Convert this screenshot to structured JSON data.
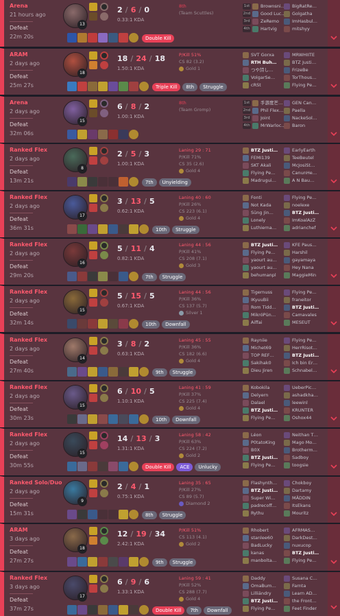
{
  "colors": {
    "loss_bg": "#59343f",
    "loss_accent": "#e84057",
    "kill_tag": "#e84057",
    "ace_tag": "#7d5cd8",
    "neutral_tag": "#6a6878"
  },
  "icons": {
    "expand": "chevron-down-icon"
  },
  "matches": [
    {
      "mode": "Arena",
      "ago": "21 hours ago",
      "result": "Defeat",
      "duration": "22m 20s",
      "level": "13",
      "kda": {
        "k": "2",
        "d": "6",
        "a": "0"
      },
      "ratio": "0.33:1 KDA",
      "champ_color": "#8a6a6a",
      "spells": [
        "#c9a227",
        "#6b4c2a"
      ],
      "rune_color": "#8a6a6a",
      "stats": {
        "line1": "8th",
        "line2": "(Team Scuttles)",
        "line3": "",
        "tier": ""
      },
      "arena": true,
      "items": [
        "#2d55a8",
        "#b07a30",
        "#c03c3c",
        "#8a6ac0",
        "#3a5a80",
        "#c04040"
      ],
      "tags": [
        {
          "label": "Double Kill",
          "kind": "red"
        }
      ],
      "team1": [
        "Brownsni…",
        "Good Luc…",
        "ZeRemo",
        "Hartvig"
      ],
      "team2": [
        "BigRatRe…",
        "Golgatha",
        "ImHasbul…",
        "mitshyy"
      ],
      "places": [
        "1st",
        "2nd",
        "3rd",
        "4th"
      ]
    },
    {
      "mode": "ARAM",
      "ago": "2 days ago",
      "result": "Defeat",
      "duration": "25m 27s",
      "level": "18",
      "kda": {
        "k": "18",
        "d": "24",
        "a": "18"
      },
      "ratio": "1.50:1 KDA",
      "champ_color": "#b05040",
      "spells": [
        "#c9a227",
        "#d08030"
      ],
      "rune_color": "#c04040",
      "stats": {
        "line1": "P/Kill 51%",
        "line2": "CS 82 (3.2)",
        "line3": "Gold 1",
        "tier": ""
      },
      "items": [
        "#3a7ac0",
        "#c04040",
        "#8a6a3a",
        "#c0a030",
        "#6a4c9a",
        "#5a8a4a",
        "#a04040"
      ],
      "tags": [
        {
          "label": "Triple Kill",
          "kind": "red"
        },
        {
          "label": "8th",
          "kind": "n"
        },
        {
          "label": "Struggle",
          "kind": "n"
        }
      ],
      "team1": [
        "SVT Gorxa",
        "RTH Buh…",
        "つや詩し…",
        "VolgarSe…",
        "cRSt"
      ],
      "team2": [
        "MRWHIITE",
        "BTZ Justi…",
        "FrizeBe",
        "TorThous…",
        "Flying Pe…"
      ],
      "me": [
        0,
        1
      ]
    },
    {
      "mode": "Arena",
      "ago": "2 days ago",
      "result": "Defeat",
      "duration": "32m 06s",
      "level": "15",
      "kda": {
        "k": "6",
        "d": "8",
        "a": "2"
      },
      "ratio": "1.00:1 KDA",
      "champ_color": "#8060a0",
      "spells": [
        "#c9a227",
        "#6b4c2a"
      ],
      "rune_color": "#806080",
      "stats": {
        "line1": "8th",
        "line2": "(Team Gromp)",
        "line3": "",
        "tier": ""
      },
      "arena": true,
      "items": [
        "#3a5aa0",
        "#c0a030",
        "#6a3a6a",
        "#8a6a4a",
        "#8a3030",
        "#3a3a5a"
      ],
      "tags": [],
      "team1": [
        "手游度芒…",
        "Phil Flex…",
        "Joint",
        "MrWarloc…"
      ],
      "team2": [
        "GEN Can…",
        "Paella",
        "NackeSol…",
        "Baron"
      ],
      "places": [
        "1st",
        "2nd",
        "3rd",
        "4th"
      ]
    },
    {
      "mode": "Ranked Flex",
      "ago": "2 days ago",
      "result": "Defeat",
      "duration": "13m 21s",
      "level": "8",
      "kda": {
        "k": "2",
        "d": "5",
        "a": "3"
      },
      "ratio": "1.00:1 KDA",
      "champ_color": "#4a6a5a",
      "spells": [
        "#c9a227",
        "#c04040"
      ],
      "rune_color": "#a04040",
      "stats": {
        "line1": "Laning 29 : 71",
        "line2": "P/Kill 71%",
        "line3": "CS 35 (2.6)",
        "tier": "Gold 4"
      },
      "items": [
        "#4a3a6a",
        "#8a8a4a",
        "#3a3a3a",
        "",
        "",
        "#c06030"
      ],
      "tags": [
        {
          "label": "7th",
          "kind": "n"
        },
        {
          "label": "Unyielding",
          "kind": "n"
        }
      ],
      "team1": [
        "BTZ Justi…",
        "FEMI139",
        "SKT Akali",
        "Flying Pe…",
        "Madrugui…"
      ],
      "team2": [
        "EarlyEarth",
        "TeeBeutel",
        "McJosiSt…",
        "CanunHe…",
        "A N Bau…"
      ],
      "me": [
        0,
        0
      ]
    },
    {
      "mode": "Ranked Flex",
      "ago": "2 days ago",
      "result": "Defeat",
      "duration": "36m 31s",
      "level": "17",
      "kda": {
        "k": "3",
        "d": "13",
        "a": "5"
      },
      "ratio": "0.62:1 KDA",
      "champ_color": "#4a5a9a",
      "spells": [
        "#c9a227",
        "#c04040"
      ],
      "rune_color": "#8a7a4a",
      "stats": {
        "line1": "Laning 40 : 60",
        "line2": "P/Kill 26%",
        "line3": "CS 223 (6.1)",
        "tier": "Gold 4"
      },
      "items": [
        "#8a4a4a",
        "#3a6a3a",
        "#6a4a8a",
        "#c0a030",
        "#3a5a8a",
        "#4a3a3a",
        "#c0a030"
      ],
      "tags": [
        {
          "label": "10th",
          "kind": "n"
        },
        {
          "label": "Struggle",
          "kind": "n"
        }
      ],
      "team1": [
        "Fonti",
        "Not Kada",
        "Süng Jin…",
        "Lonely",
        "Luthierna…"
      ],
      "team2": [
        "Flying Pe…",
        "noelexe",
        "BTZ Justi…",
        "ImKoalAzZ",
        "adrianchef"
      ],
      "me": [
        1,
        2
      ]
    },
    {
      "mode": "Ranked Flex",
      "ago": "2 days ago",
      "result": "Defeat",
      "duration": "29m 20s",
      "level": "16",
      "kda": {
        "k": "5",
        "d": "11",
        "a": "4"
      },
      "ratio": "0.82:1 KDA",
      "champ_color": "#7a3a3a",
      "spells": [
        "#c9a227",
        "#c04040"
      ],
      "rune_color": "#7a8a4a",
      "stats": {
        "line1": "Laning 44 : 56",
        "line2": "P/Kill 41%",
        "line3": "CS 208 (7.1)",
        "tier": "Gold 3"
      },
      "items": [
        "#4a5a8a",
        "#8a3a3a",
        "#3a3a3a",
        "#8a8a4a",
        "",
        "#3a5a8a"
      ],
      "tags": [
        {
          "label": "7th",
          "kind": "n"
        },
        {
          "label": "Struggle",
          "kind": "n"
        }
      ],
      "team1": [
        "BTZ Justi…",
        "Flying Pe…",
        "yaourt au…",
        "yaourt au…",
        "behumanpl"
      ],
      "team2": [
        "KFE Paus…",
        "Harshil",
        "gayamaya",
        "Hey Nana",
        "MaggieMin"
      ],
      "me": [
        0,
        0
      ]
    },
    {
      "mode": "Ranked Flex",
      "ago": "2 days ago",
      "result": "Defeat",
      "duration": "32m 14s",
      "level": "15",
      "kda": {
        "k": "5",
        "d": "15",
        "a": "5"
      },
      "ratio": "0.67:1 KDA",
      "champ_color": "#8a6a3a",
      "spells": [
        "#c9a227",
        "#c04040"
      ],
      "rune_color": "#a04040",
      "stats": {
        "line1": "Laning 44 : 56",
        "line2": "P/Kill 36%",
        "line3": "CS 137 (5.7)",
        "tier": "Silver 1"
      },
      "items": [
        "#3a4a6a",
        "#6a3a3a",
        "#8a3a3a",
        "#c0a030",
        "#5a4a3a",
        "#8a3a4a"
      ],
      "tags": [
        {
          "label": "10th",
          "kind": "n"
        },
        {
          "label": "Downfall",
          "kind": "n"
        }
      ],
      "team1": [
        "Tigernuss",
        "IKyuuBii",
        "Rom Tidd…",
        "MikróPün…",
        "Aiffai"
      ],
      "team2": [
        "Flying Pe…",
        "franeitor",
        "BTZ Justi…",
        "Camavales",
        "MESEUT"
      ],
      "me": [
        1,
        2
      ]
    },
    {
      "mode": "Ranked Flex",
      "ago": "2 days ago",
      "result": "Defeat",
      "duration": "27m 40s",
      "level": "14",
      "kda": {
        "k": "3",
        "d": "8",
        "a": "2"
      },
      "ratio": "0.63:1 KDA",
      "champ_color": "#a07a6a",
      "spells": [
        "#c9a227",
        "#c04040"
      ],
      "rune_color": "#8a7a4a",
      "stats": {
        "line1": "Laning 45 : 55",
        "line2": "P/Kill 36%",
        "line3": "CS 182 (6.6)",
        "tier": "Gold 4"
      },
      "items": [
        "#4a6a8a",
        "#6a4a8a",
        "#c0a030",
        "#3a5a8a",
        "#8a6a3a",
        "#4a3a3a",
        "#c0a030"
      ],
      "tags": [
        {
          "label": "9th",
          "kind": "n"
        },
        {
          "label": "Struggle",
          "kind": "n"
        }
      ],
      "team1": [
        "Rayniie",
        "Michet69",
        "TOP REF…",
        "Sakihak0",
        "Dieu Jiren"
      ],
      "team2": [
        "Flying Pe…",
        "HerrRisot…",
        "BTZ Justi…",
        "Ich bin Er…",
        "Schnabel…"
      ],
      "me": [
        1,
        2
      ]
    },
    {
      "mode": "Ranked Flex",
      "ago": "2 days ago",
      "result": "Defeat",
      "duration": "30m 23s",
      "level": "15",
      "kda": {
        "k": "6",
        "d": "10",
        "a": "5"
      },
      "ratio": "1.10:1 KDA",
      "champ_color": "#6a5a8a",
      "spells": [
        "#c9a227",
        "#c04040"
      ],
      "rune_color": "#8a7a4a",
      "stats": {
        "line1": "Laning 41 : 59",
        "line2": "P/Kill 37%",
        "line3": "CS 225 (7.4)",
        "tier": "Gold 4"
      },
      "items": [
        "#3a3a3a",
        "#6a6a8a",
        "#c0a030",
        "#8a4a4a",
        "#3a6a9a",
        "#4a4a5a",
        "#3a6a9a"
      ],
      "tags": [
        {
          "label": "10th",
          "kind": "n"
        },
        {
          "label": "Downfall",
          "kind": "n"
        }
      ],
      "team1": [
        "Kobokila",
        "Delyern",
        "Dalael",
        "BTZ Justi…",
        "Flying Pe…"
      ],
      "team2": [
        "UeberPic…",
        "ashadkha…",
        "leewinl",
        "KRUNTER",
        "Oshox44"
      ],
      "me": [
        0,
        3
      ]
    },
    {
      "mode": "Ranked Flex",
      "ago": "2 days ago",
      "result": "Defeat",
      "duration": "30m 55s",
      "level": "15",
      "kda": {
        "k": "14",
        "d": "13",
        "a": "3"
      },
      "ratio": "1.31:1 KDA",
      "champ_color": "#3a4a5a",
      "spells": [
        "#c9a227",
        "#c04040"
      ],
      "rune_color": "#a04060",
      "stats": {
        "line1": "Laning 58 : 42",
        "line2": "P/Kill 63%",
        "line3": "CS 224 (7.2)",
        "tier": "Gold 2"
      },
      "items": [
        "#3a6a9a",
        "#6a6a8a",
        "#8a3a3a",
        "#4a3a3a",
        "#8a4a6a",
        "#3a6a9a"
      ],
      "tags": [
        {
          "label": "Double Kill",
          "kind": "red"
        },
        {
          "label": "ACE",
          "kind": "ace"
        },
        {
          "label": "Unlucky",
          "kind": "n"
        }
      ],
      "team1": [
        "Léon",
        "P0tatoKing",
        "B0X",
        "BTZ Justi…",
        "Flying Pe…"
      ],
      "team2": [
        "Neithan T…",
        "Mago Mo…",
        "Brotherm…",
        "Sadboy",
        "toogsie"
      ],
      "me": [
        0,
        3
      ]
    },
    {
      "mode": "Ranked Solo/Duo",
      "ago": "2 days ago",
      "result": "Defeat",
      "duration": "15m 31s",
      "level": "9",
      "kda": {
        "k": "2",
        "d": "4",
        "a": "1"
      },
      "ratio": "0.75:1 KDA",
      "champ_color": "#3a7aa0",
      "spells": [
        "#c9a227",
        "#c04040"
      ],
      "rune_color": "#8a7a4a",
      "stats": {
        "line1": "Laning 35 : 65",
        "line2": "P/Kill 27%",
        "line3": "CS 89 (5.7)",
        "tier": "Diamond 2"
      },
      "items": [
        "#6a4a8a",
        "#3a3a3a",
        "#3a5a8a",
        "",
        "",
        "#c0a030"
      ],
      "tags": [
        {
          "label": "8th",
          "kind": "n"
        },
        {
          "label": "Struggle",
          "kind": "n"
        }
      ],
      "team1": [
        "Flashynth…",
        "BTZ Justi…",
        "Super Wi…",
        "padrecoff…",
        "Rythu"
      ],
      "team2": [
        "Chokboy",
        "Dartamy",
        "MÄDDIN",
        "ItsEkans",
        "Mouritz"
      ],
      "me": [
        0,
        1
      ]
    },
    {
      "mode": "ARAM",
      "ago": "3 days ago",
      "result": "Defeat",
      "duration": "27m 27s",
      "level": "18",
      "kda": {
        "k": "12",
        "d": "19",
        "a": "34"
      },
      "ratio": "2.42:1 KDA",
      "champ_color": "#8a6a4a",
      "spells": [
        "#c9a227",
        "#d08030"
      ],
      "rune_color": "#5a8a4a",
      "stats": {
        "line1": "P/Kill 51%",
        "line2": "CS 113 (4.1)",
        "line3": "Gold 2",
        "tier": ""
      },
      "items": [
        "#6a4a8a",
        "#3a6a9a",
        "#c0a030",
        "#8a3a3a",
        "#4a4a4a",
        "#5a3a6a",
        "#c0a030"
      ],
      "tags": [
        {
          "label": "9th",
          "kind": "n"
        },
        {
          "label": "Struggle",
          "kind": "n"
        }
      ],
      "team1": [
        "Rhobert",
        "stanlee60",
        "BadLucky",
        "kanas",
        "manbolta…"
      ],
      "team2": [
        "AFRMAS…",
        "DarkDest…",
        "nuxucop",
        "BTZ Justi…",
        "Flying Pe…"
      ],
      "me": [
        1,
        3
      ]
    },
    {
      "mode": "Ranked Flex",
      "ago": "3 days ago",
      "result": "Defeat",
      "duration": "37m 27s",
      "level": "17",
      "kda": {
        "k": "6",
        "d": "9",
        "a": "6"
      },
      "ratio": "1.33:1 KDA",
      "champ_color": "#4a4a6a",
      "spells": [
        "#c9a227",
        "#c04040"
      ],
      "rune_color": "#8a7a4a",
      "stats": {
        "line1": "Laning 59 : 41",
        "line2": "P/Kill 52%",
        "line3": "CS 288 (7.7)",
        "tier": "Gold 4"
      },
      "items": [
        "#3a6a9a",
        "#6a4a8a",
        "#3a3a3a",
        "#8a6a3a",
        "#3a5a8a",
        "#c0a030",
        "#4a3a3a"
      ],
      "tags": [
        {
          "label": "Double Kill",
          "kind": "red"
        },
        {
          "label": "7th",
          "kind": "n"
        },
        {
          "label": "Downfall",
          "kind": "n"
        }
      ],
      "team1": [
        "Daddy",
        "OmaBum…",
        "Lilliändry",
        "BTZ Justi…",
        "Flying Pe…"
      ],
      "team2": [
        "Susana C…",
        "Farnta",
        "Learn AD…",
        "the Front…",
        "Feet Finder"
      ],
      "me": [
        0,
        3
      ]
    }
  ]
}
